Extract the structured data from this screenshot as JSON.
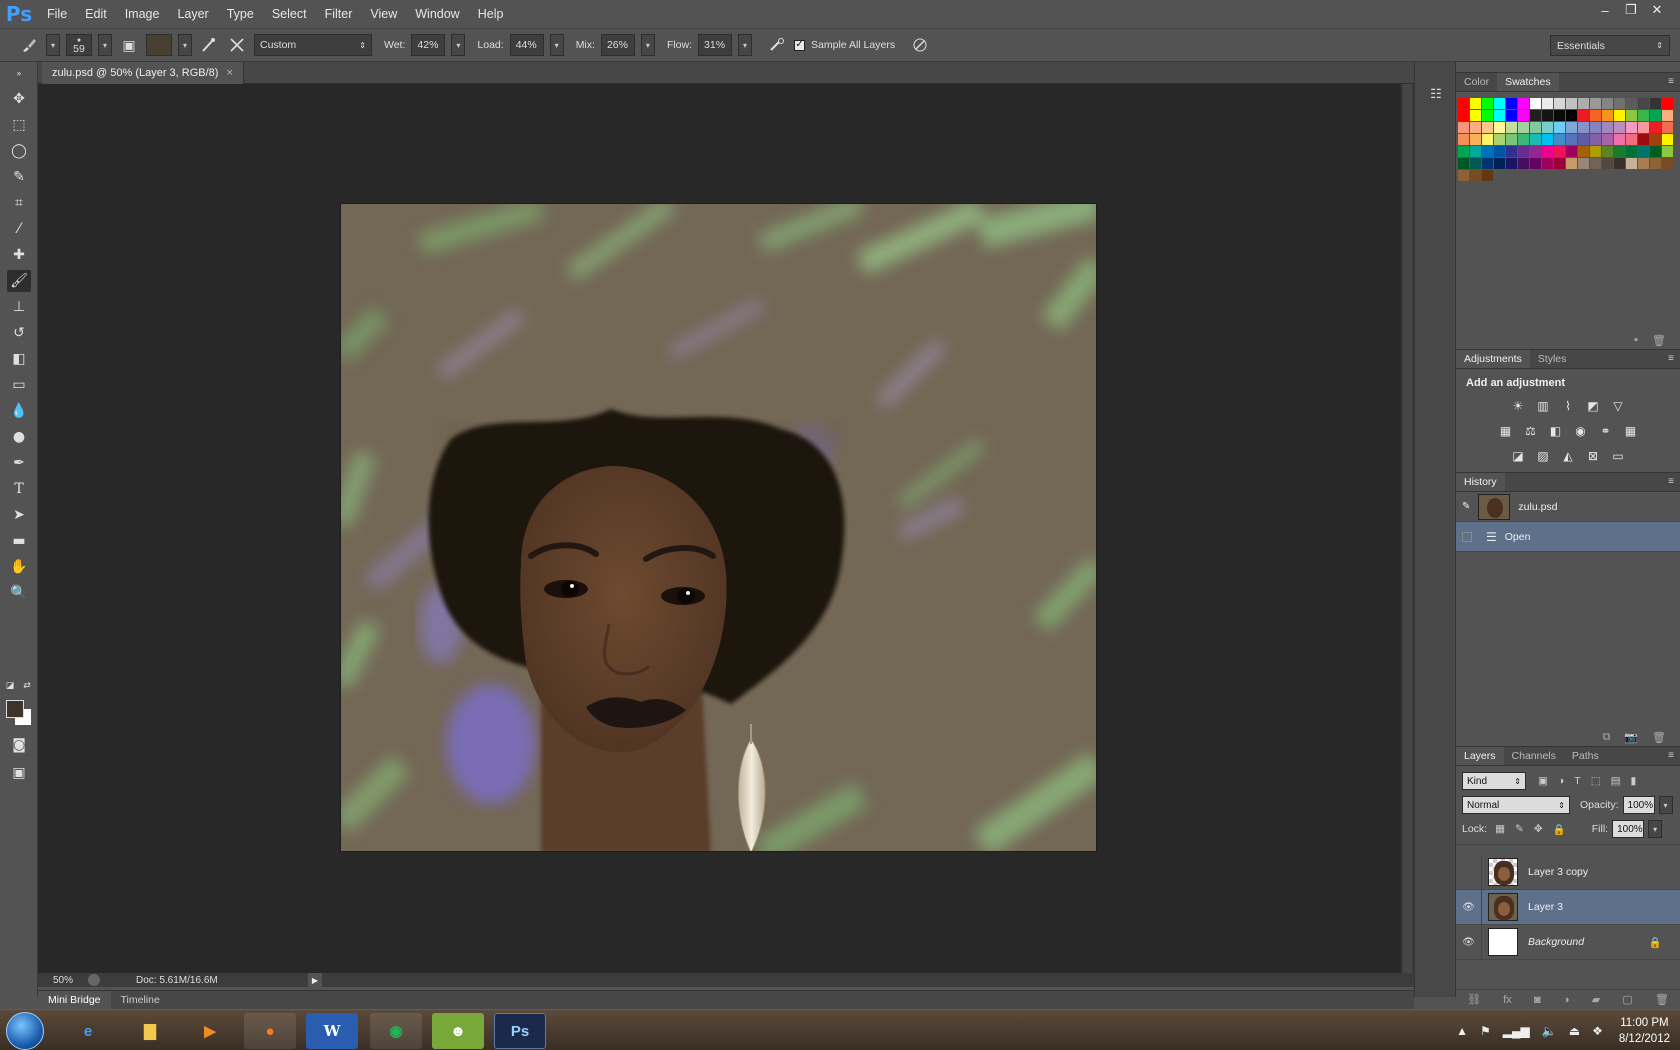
{
  "app": {
    "logo": "Ps",
    "menu": [
      "File",
      "Edit",
      "Image",
      "Layer",
      "Type",
      "Select",
      "Filter",
      "View",
      "Window",
      "Help"
    ],
    "window_controls": [
      "–",
      "❐",
      "✕"
    ]
  },
  "options_bar": {
    "brush_size": "59",
    "preset": "Custom",
    "wet_label": "Wet:",
    "wet_value": "42%",
    "load_label": "Load:",
    "load_value": "44%",
    "mix_label": "Mix:",
    "mix_value": "26%",
    "flow_label": "Flow:",
    "flow_value": "31%",
    "sample_all_layers_label": "Sample All Layers",
    "sample_all_layers_checked": true,
    "workspace": "Essentials"
  },
  "document": {
    "tab_title": "zulu.psd @ 50% (Layer 3, RGB/8)",
    "zoom": "50%",
    "doc_size": "Doc: 5.61M/16.6M"
  },
  "bottom_tabs": [
    "Mini Bridge",
    "Timeline"
  ],
  "panels": {
    "color_tabs": [
      "Color",
      "Swatches"
    ],
    "adjustments_tabs": [
      "Adjustments",
      "Styles"
    ],
    "adjustments_title": "Add an adjustment",
    "history_tab": "History",
    "history_items": [
      {
        "label": "zulu.psd",
        "selected": false
      },
      {
        "label": "Open",
        "selected": true
      }
    ],
    "layers_tabs": [
      "Layers",
      "Channels",
      "Paths"
    ],
    "filter_kind": "Kind",
    "blend_mode": "Normal",
    "opacity_label": "Opacity:",
    "opacity_value": "100%",
    "lock_label": "Lock:",
    "fill_label": "Fill:",
    "fill_value": "100%",
    "layers": [
      {
        "name": "Layer 3 copy",
        "visible": false,
        "selected": false
      },
      {
        "name": "Layer 3",
        "visible": true,
        "selected": true
      },
      {
        "name": "Background",
        "visible": true,
        "selected": false
      }
    ]
  },
  "taskbar": {
    "time": "11:00 PM",
    "date": "8/12/2012"
  }
}
